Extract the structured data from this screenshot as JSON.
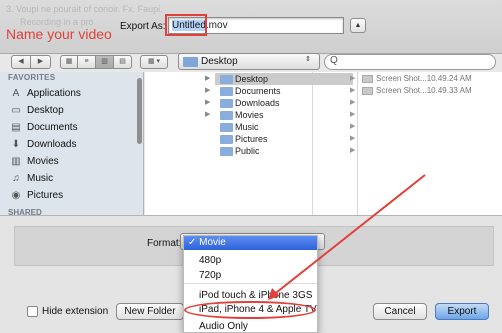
{
  "dialog": {
    "ghost_line_1": "3. Voupi ne pourait of conoir. Fx. Faupi.",
    "ghost_line_2": "Recording in a pro",
    "annotation_label": "Name your video",
    "export_as_label": "Export As:",
    "filename_selected": "Untitled",
    "filename_ext": ".mov",
    "expand_icon": "chevron-up-icon"
  },
  "toolbar": {
    "back_icon": "◀",
    "forward_icon": "▶",
    "view_icons": "▦",
    "view_list": "≡",
    "view_columns": "▥",
    "view_flow": "▤",
    "arrange_icon": "▦ ▾",
    "location": "Desktop",
    "location_arrows": "⇕",
    "search_icon": "Q"
  },
  "sidebar": {
    "favorites_heading": "FAVORITES",
    "shared_heading": "SHARED",
    "items": [
      {
        "label": "Applications",
        "icon": "A"
      },
      {
        "label": "Desktop",
        "icon": "▭"
      },
      {
        "label": "Documents",
        "icon": "▤"
      },
      {
        "label": "Downloads",
        "icon": "⬇"
      },
      {
        "label": "Movies",
        "icon": "▥"
      },
      {
        "label": "Music",
        "icon": "♫"
      },
      {
        "label": "Pictures",
        "icon": "◉"
      }
    ]
  },
  "browser": {
    "folders": [
      "Desktop",
      "Documents",
      "Downloads",
      "Movies",
      "Music",
      "Pictures",
      "Public"
    ],
    "selected_folder": "Desktop",
    "files": [
      "Screen Shot...10.49.24 AM",
      "Screen Shot...10.49.33 AM"
    ]
  },
  "options": {
    "format_label": "Format:",
    "menu_selected": "✓ Movie",
    "menu_items": [
      "480p",
      "720p",
      "iPod touch & iPhone 3GS",
      "iPad, iPhone 4 & Apple TV",
      "Audio Only"
    ]
  },
  "footer": {
    "hide_extension_label": "Hide extension",
    "new_folder_label": "New Folder",
    "cancel_label": "Cancel",
    "export_label": "Export"
  },
  "colors": {
    "annotation_red": "#e2403a",
    "menu_highlight": "#2c62dc",
    "folder_blue": "#8aaedb"
  }
}
